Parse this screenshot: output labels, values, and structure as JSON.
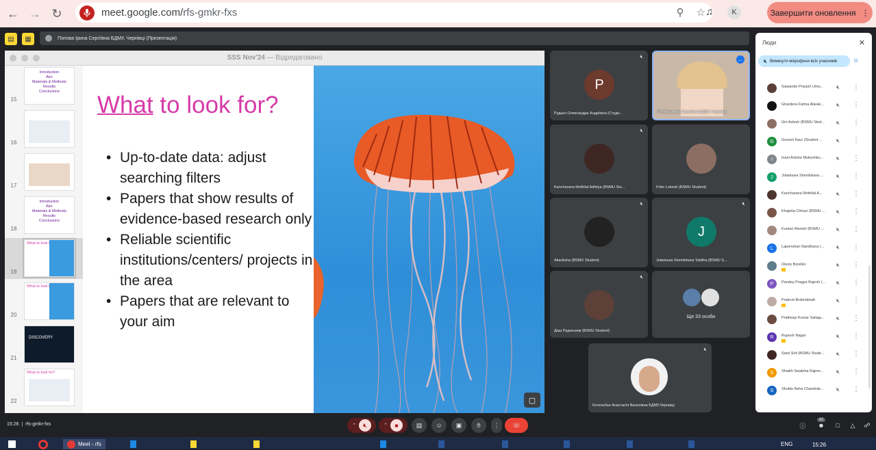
{
  "browser": {
    "url_domain": "meet.google.com/",
    "url_path": "rfs-gmkr-fxs",
    "profile_initial": "K",
    "update_button": "Завершити оновлення"
  },
  "presenter_bar": {
    "label": "Попова Ірина Сергіївна БДМУ, Чернівці (Презентація)"
  },
  "keynote": {
    "window_title": "SSS Nov'24",
    "edited_label": "— Відредаговано",
    "thumbnails": [
      {
        "num": "15",
        "text": "Introduction\nAim\nMaterials & Methods\nResults\nConclusions"
      },
      {
        "num": "16",
        "text": ""
      },
      {
        "num": "17",
        "text": ""
      },
      {
        "num": "18",
        "text": "Introduction\nAim\nMaterials & Methods\nResults\nConclusions"
      },
      {
        "num": "19",
        "text": "What to look for?"
      },
      {
        "num": "20",
        "text": "What to look for?"
      },
      {
        "num": "21",
        "text": "DISCOVERY"
      },
      {
        "num": "22",
        "text": "What to look for?"
      }
    ]
  },
  "slide": {
    "title_underlined": "What",
    "title_rest": " to look for?",
    "bullets": [
      "Up-to-date data: adjust searching filters",
      "Papers that show results of evidence-based research only",
      "Reliable scientific institutions/centers/ projects in the area",
      "Papers that are relevant to your aim"
    ]
  },
  "tiles": [
    {
      "name": "Рудько Олександра Андріївна (Студе...",
      "initial": "P",
      "color": "#6d3a2e"
    },
    {
      "name": "Попова Ірина Сергіївна БДМУ, Чернівці"
    },
    {
      "name": "Kancharana Mothilal Adhitya (BSMU Stu..."
    },
    {
      "name": "Firke Lokesh (BSMU Student)"
    },
    {
      "name": "Akanksha (BSMU Student)"
    },
    {
      "name": "Jolaoluwa Sinmiloluwa Tabitha (BSMU S...",
      "initial": "J",
      "color": "#0f7a6a"
    },
    {
      "name": "Даш Радхешям (BSMU Student)"
    },
    {
      "name": "Ще 33 особи"
    },
    {
      "name": "Котельбан Анастасія Василівна БДМУ,Чернівці"
    }
  ],
  "people_panel": {
    "title": "Люди",
    "mute_all": "Вимкнути мікрофони всіх учасників",
    "participants": [
      {
        "name": "Gawande Priyash Uma...",
        "initial": "",
        "color": "#5d4037"
      },
      {
        "name": "Ghardera Fatma Alarak...",
        "initial": "",
        "color": "#111111"
      },
      {
        "name": "Giri Ashish (BSMU Stud...",
        "initial": "",
        "color": "#8d6e63"
      },
      {
        "name": "Guneet Kaur (Student ...",
        "initial": "G",
        "color": "#1e8e3e"
      },
      {
        "name": "Inani Anisha Mukeshku...",
        "initial": "I",
        "color": "#80868b"
      },
      {
        "name": "Jolaoluwa Sinmiloluwa ...",
        "initial": "J",
        "color": "#12a06b"
      },
      {
        "name": "Kancharana Mothilal A...",
        "initial": "",
        "color": "#4e342e"
      },
      {
        "name": "Khajotia Chhavi (BSMU ...",
        "initial": "",
        "color": "#795548"
      },
      {
        "name": "Kumari Manshi (BSMU ...",
        "initial": "",
        "color": "#a1887f"
      },
      {
        "name": "Lajeendran Nandhana (...",
        "initial": "L",
        "color": "#1a73e8"
      },
      {
        "name": "Olexiy Borelko",
        "initial": "",
        "color": "#607d8b",
        "sub": true
      },
      {
        "name": "Pandey Pragya Rajesh (...",
        "initial": "P",
        "color": "#7e57c2"
      },
      {
        "name": "Prakruti Brahmbhatt",
        "initial": "",
        "color": "#bcaaa4",
        "sub": true
      },
      {
        "name": "Pratheep Kumar Sailaja...",
        "initial": "",
        "color": "#6d4c41"
      },
      {
        "name": "Rupesh Nagar",
        "initial": "R",
        "color": "#5e35b1",
        "sub": true
      },
      {
        "name": "Saini Siril (BSMU Stude...",
        "initial": "",
        "color": "#3e2723"
      },
      {
        "name": "Shaikh Swaleha Rajmo...",
        "initial": "S",
        "color": "#f29900"
      },
      {
        "name": "Shukla Neha Chandrak...",
        "initial": "S",
        "color": "#1565c0"
      }
    ]
  },
  "bottom_bar": {
    "time": "15:26",
    "meeting_code": "rfs-gmkr-fxs",
    "participant_count": "42"
  },
  "taskbar": {
    "clock": "15:26",
    "lang": "ENG",
    "chrome_label": "Meet - rfs"
  }
}
